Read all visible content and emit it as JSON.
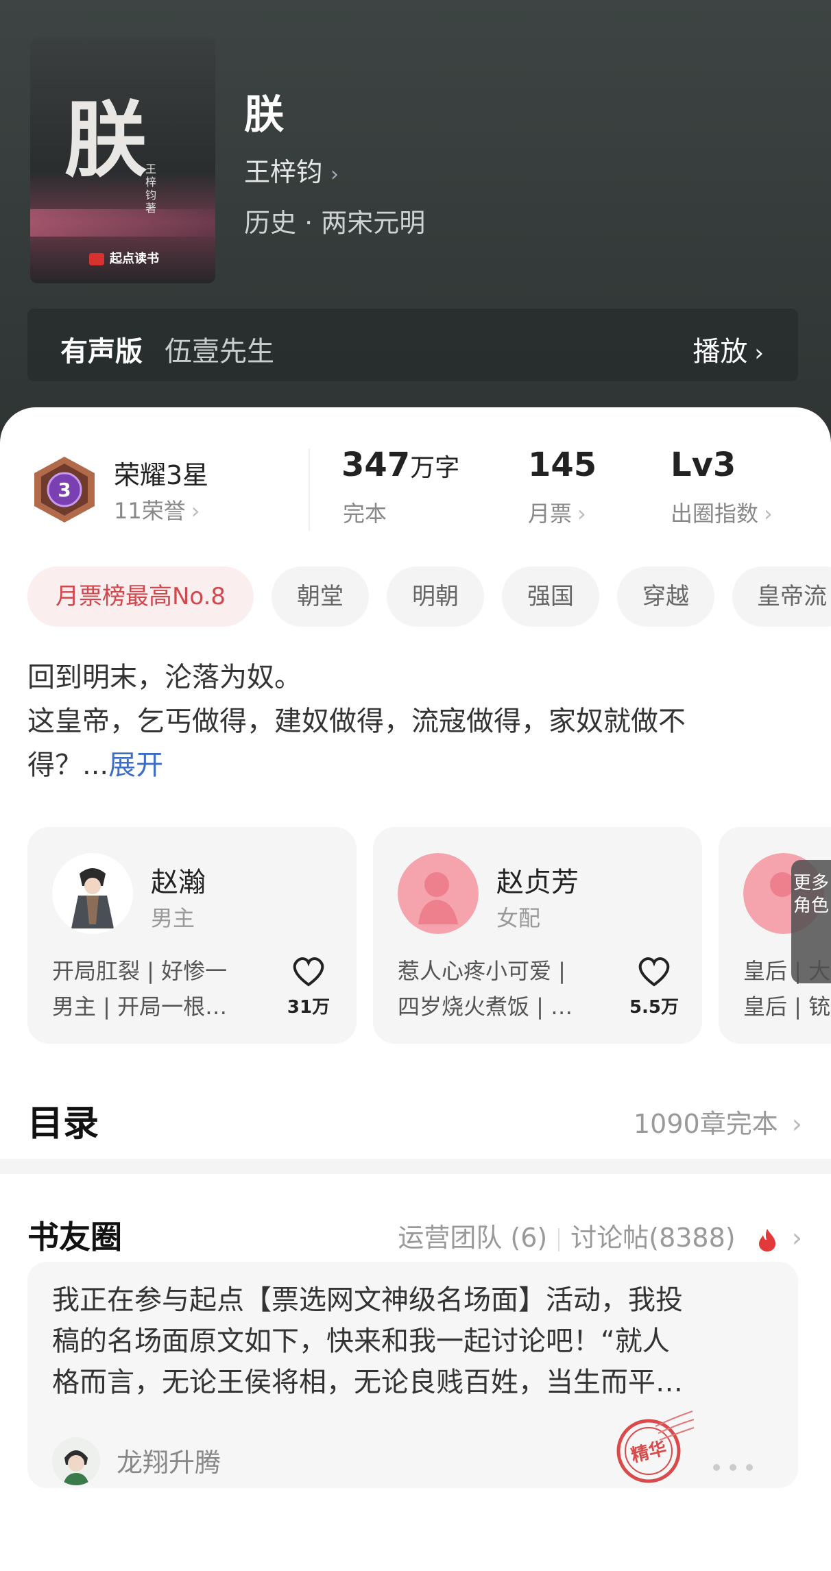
{
  "book": {
    "title": "朕",
    "author": "王梓钧",
    "genre": "历史 · 两宋元明",
    "cover": {
      "big_char": "朕",
      "author_vertical": "王梓钧著",
      "brand": "起点读书"
    }
  },
  "audio": {
    "label": "有声版",
    "narrator": "伍壹先生",
    "play_label": "播放"
  },
  "stats": {
    "honor": {
      "title": "荣耀3星",
      "sub": "11荣誉",
      "badge_num": "3"
    },
    "words": {
      "value": "347",
      "unit": "万字",
      "label": "完本"
    },
    "monthly": {
      "value": "145",
      "label": "月票"
    },
    "level": {
      "value": "Lv3",
      "label": "出圈指数"
    }
  },
  "tags": [
    "月票榜最高No.8",
    "朝堂",
    "明朝",
    "强国",
    "穿越",
    "皇帝流"
  ],
  "description": {
    "line1": "回到明末，沦落为奴。",
    "line2": "这皇帝，乞丐做得，建奴做得，流寇做得，家奴就做不",
    "line3": "得？...",
    "expand": "展开"
  },
  "roles": [
    {
      "name": "赵瀚",
      "type": "男主",
      "intro1": "开局肛裂 | 好惨一",
      "intro2": "男主 | 开局一根…",
      "likes": "31万"
    },
    {
      "name": "赵贞芳",
      "type": "女配",
      "intro1": "惹人心疼小可爱 |",
      "intro2": "四岁烧火煮饭 | …",
      "likes": "5.5万"
    },
    {
      "name": "",
      "type": "",
      "intro1": "皇后 | 大",
      "intro2": "皇后 | 铳",
      "likes": ""
    }
  ],
  "more_roles": "更多角色",
  "toc": {
    "title": "目录",
    "summary": "1090章完本"
  },
  "circle": {
    "title": "书友圈",
    "ops": "运营团队 (6)",
    "posts": "讨论帖(8388)",
    "post": {
      "line1": "我正在参与起点【票选网文神级名场面】活动，我投",
      "line2": "稿的名场面原文如下，快来和我一起讨论吧！“就人",
      "line3": "格而言，无论王侯将相，无论良贱百姓，当生而平…",
      "user": "龙翔升腾",
      "stamp": "精华"
    }
  },
  "colors": {
    "accent_red": "#d0484d",
    "link_blue": "#3d6cc4",
    "header_bg": "#3a4040"
  }
}
